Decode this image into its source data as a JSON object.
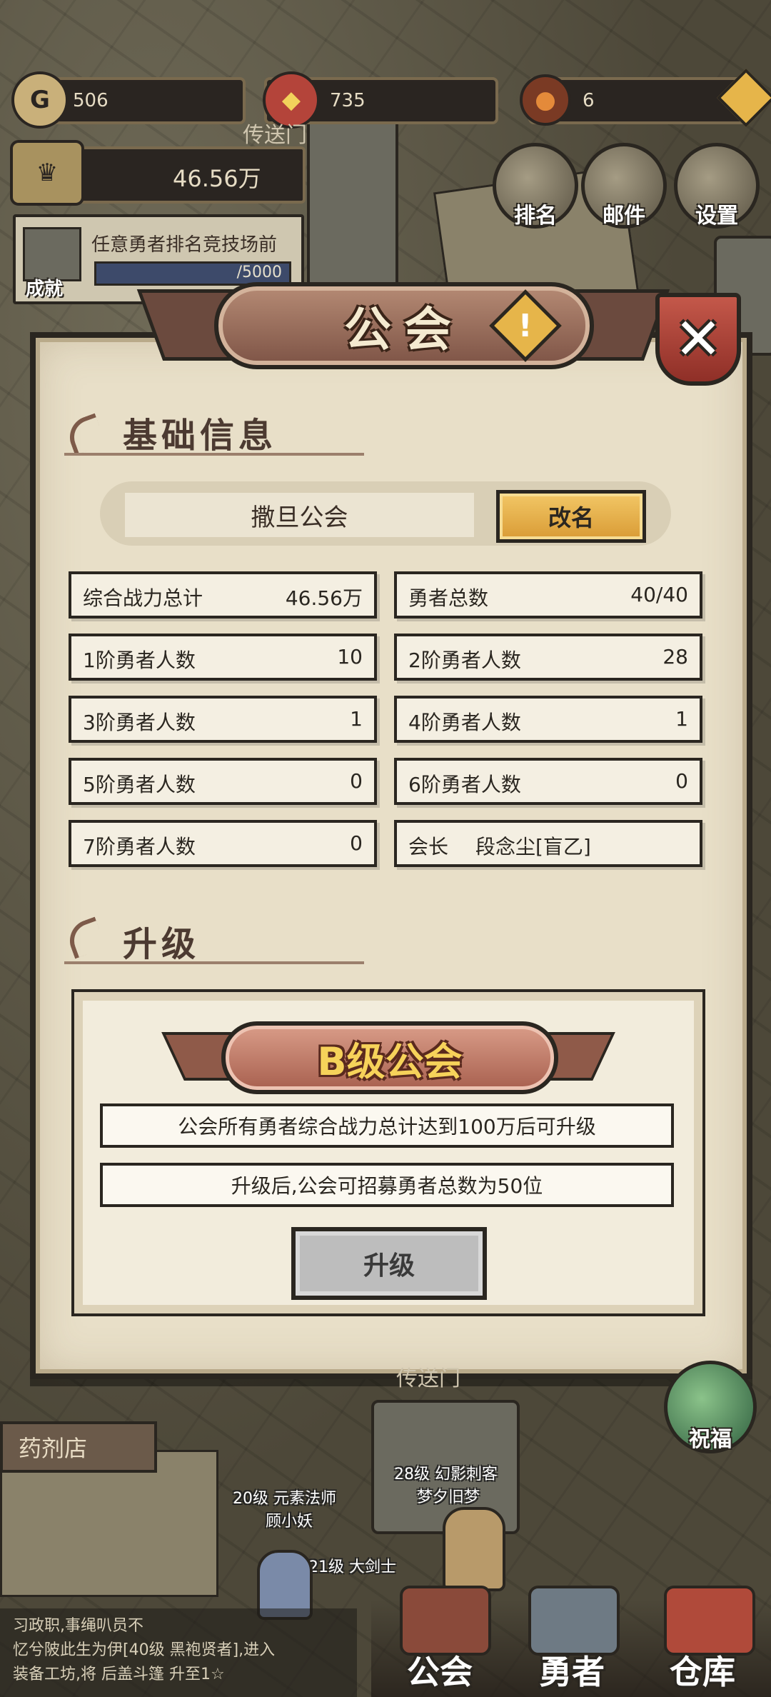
{
  "hud": {
    "gold": "506",
    "gems": "735",
    "ore": "6",
    "power": "46.56万",
    "quest_text": "任意勇者排名竞技场前",
    "quest_progress": "/5000",
    "achievement_label": "成就",
    "map_sign": "传送门",
    "buttons": {
      "rank": "排名",
      "mail": "邮件",
      "settings": "设置"
    }
  },
  "modal": {
    "title": "公会",
    "close_icon": "close-icon",
    "basic_info_title": "基础信息",
    "guild_name": "撒旦公会",
    "rename_label": "改名",
    "stats": [
      {
        "label": "综合战力总计",
        "value": "46.56万"
      },
      {
        "label": "勇者总数",
        "value": "40/40"
      },
      {
        "label": "1阶勇者人数",
        "value": "10"
      },
      {
        "label": "2阶勇者人数",
        "value": "28"
      },
      {
        "label": "3阶勇者人数",
        "value": "1"
      },
      {
        "label": "4阶勇者人数",
        "value": "1"
      },
      {
        "label": "5阶勇者人数",
        "value": "0"
      },
      {
        "label": "6阶勇者人数",
        "value": "0"
      },
      {
        "label": "7阶勇者人数",
        "value": "0"
      },
      {
        "label": "会长",
        "value": "段念尘[盲乙]"
      }
    ],
    "upgrade_title": "升级",
    "grade": "B级公会",
    "requirement": "公会所有勇者综合战力总计达到100万后可升级",
    "benefit": "升级后,公会可招募勇者总数为50位",
    "upgrade_button": "升级"
  },
  "world": {
    "shop_label": "药剂店",
    "portal_label": "传送门",
    "bless_label": "祝福",
    "npc1": "20级 元素法师",
    "npc1_name": "顾小妖",
    "npc2": "28级 幻影刺客",
    "npc2_name": "梦夕旧梦",
    "npc3": "21级 大剑士"
  },
  "chat": {
    "line1": "习政职,事绳叭员不",
    "line2": "忆兮陂此生为伊[40级 黑袍贤者],进入",
    "line3": "装备工坊,将 后盖斗篷 升至1☆"
  },
  "nav": {
    "guild": "公会",
    "heroes": "勇者",
    "warehouse": "仓库"
  }
}
